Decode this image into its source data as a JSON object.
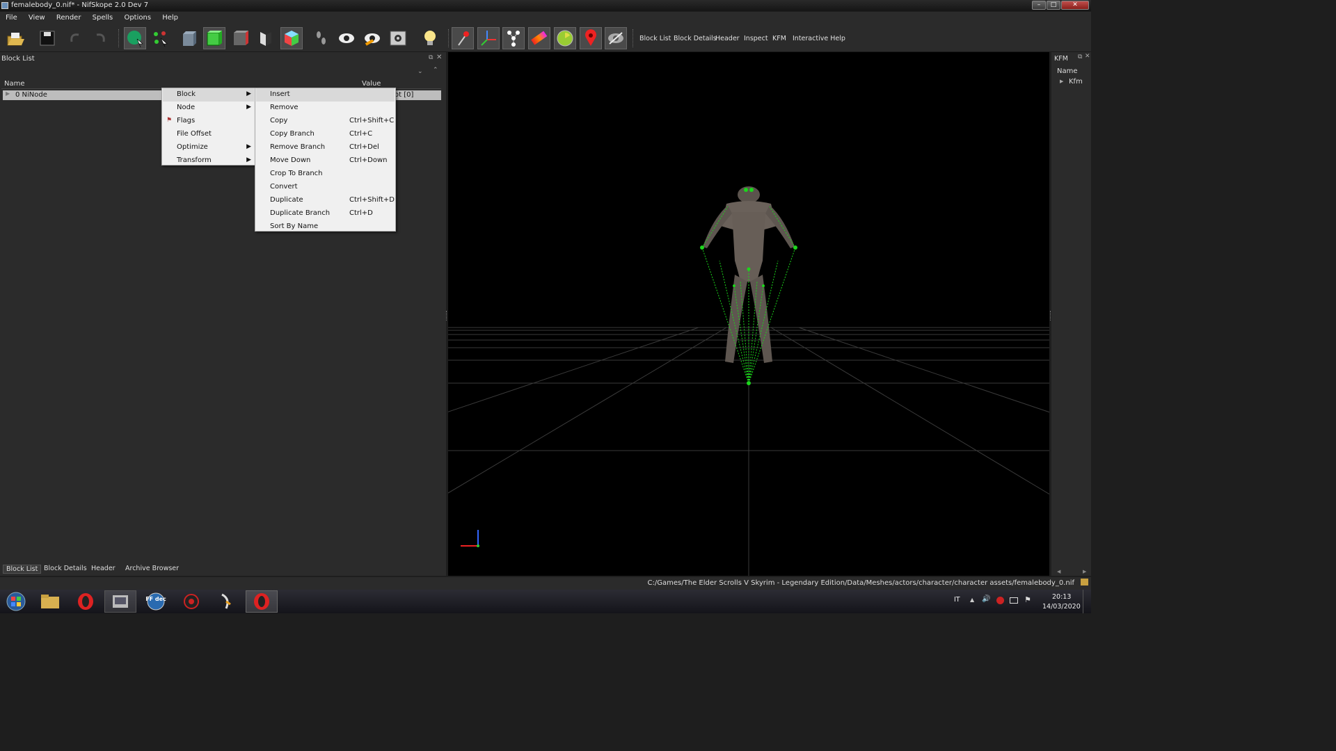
{
  "window": {
    "title": "femalebody_0.nif* - NifSkope 2.0 Dev 7"
  },
  "menubar": [
    "File",
    "View",
    "Render",
    "Spells",
    "Options",
    "Help"
  ],
  "toolbar": {
    "icons": [
      "open-icon",
      "save-icon",
      "undo-icon",
      "redo-icon",
      "select-object-icon",
      "select-vertex-icon",
      "box-icon",
      "green-box-icon",
      "red-box-icon",
      "flip-icon",
      "cube-icon",
      "footprint-icon",
      "eye-icon",
      "eye-orange-icon",
      "screenshot-icon",
      "light-icon",
      "pin-icon",
      "axes-icon",
      "nodes-icon",
      "gradient-icon",
      "clock-icon",
      "marker-icon",
      "hidden-eye-icon"
    ],
    "text_buttons": [
      "Block List",
      "Block Details",
      "Header",
      "Inspect",
      "KFM",
      "Interactive Help"
    ]
  },
  "block_list": {
    "title": "Block List",
    "columns": [
      "Name",
      "Value"
    ],
    "rows": [
      {
        "name": "0 NiNode",
        "value": "ot [0]"
      }
    ]
  },
  "context_menu": {
    "items": [
      {
        "label": "Block",
        "submenu": true
      },
      {
        "label": "Node",
        "submenu": true
      },
      {
        "label": "Flags",
        "submenu": false
      },
      {
        "label": "File Offset",
        "submenu": false
      },
      {
        "label": "Optimize",
        "submenu": true
      },
      {
        "label": "Transform",
        "submenu": true
      }
    ],
    "block_submenu": [
      {
        "label": "Insert",
        "shortcut": ""
      },
      {
        "label": "Remove",
        "shortcut": ""
      },
      {
        "label": "Copy",
        "shortcut": "Ctrl+Shift+C"
      },
      {
        "label": "Copy Branch",
        "shortcut": "Ctrl+C"
      },
      {
        "label": "Remove Branch",
        "shortcut": "Ctrl+Del"
      },
      {
        "label": "Move Down",
        "shortcut": "Ctrl+Down"
      },
      {
        "label": "Crop To Branch",
        "shortcut": ""
      },
      {
        "label": "Convert",
        "shortcut": ""
      },
      {
        "label": "Duplicate",
        "shortcut": "Ctrl+Shift+D"
      },
      {
        "label": "Duplicate Branch",
        "shortcut": "Ctrl+D"
      },
      {
        "label": "Sort By Name",
        "shortcut": ""
      }
    ]
  },
  "bottom_tabs": [
    "Block List",
    "Block Details",
    "Header",
    "Archive Browser"
  ],
  "kfm_panel": {
    "title": "KFM",
    "column": "Name",
    "item": "Kfm"
  },
  "status": {
    "path": "C:/Games/The Elder Scrolls V Skyrim - Legendary Edition/Data/Meshes/actors/character/character assets/femalebody_0.nif"
  },
  "taskbar": {
    "apps": [
      "windows-start-icon",
      "explorer-icon",
      "opera-icon",
      "media-icon",
      "ffdec-icon",
      "game-icon",
      "nifskope-icon",
      "opera-active-icon"
    ],
    "ffdec_label": "FF dec",
    "language": "IT",
    "time": "20:13",
    "date": "14/03/2020"
  }
}
